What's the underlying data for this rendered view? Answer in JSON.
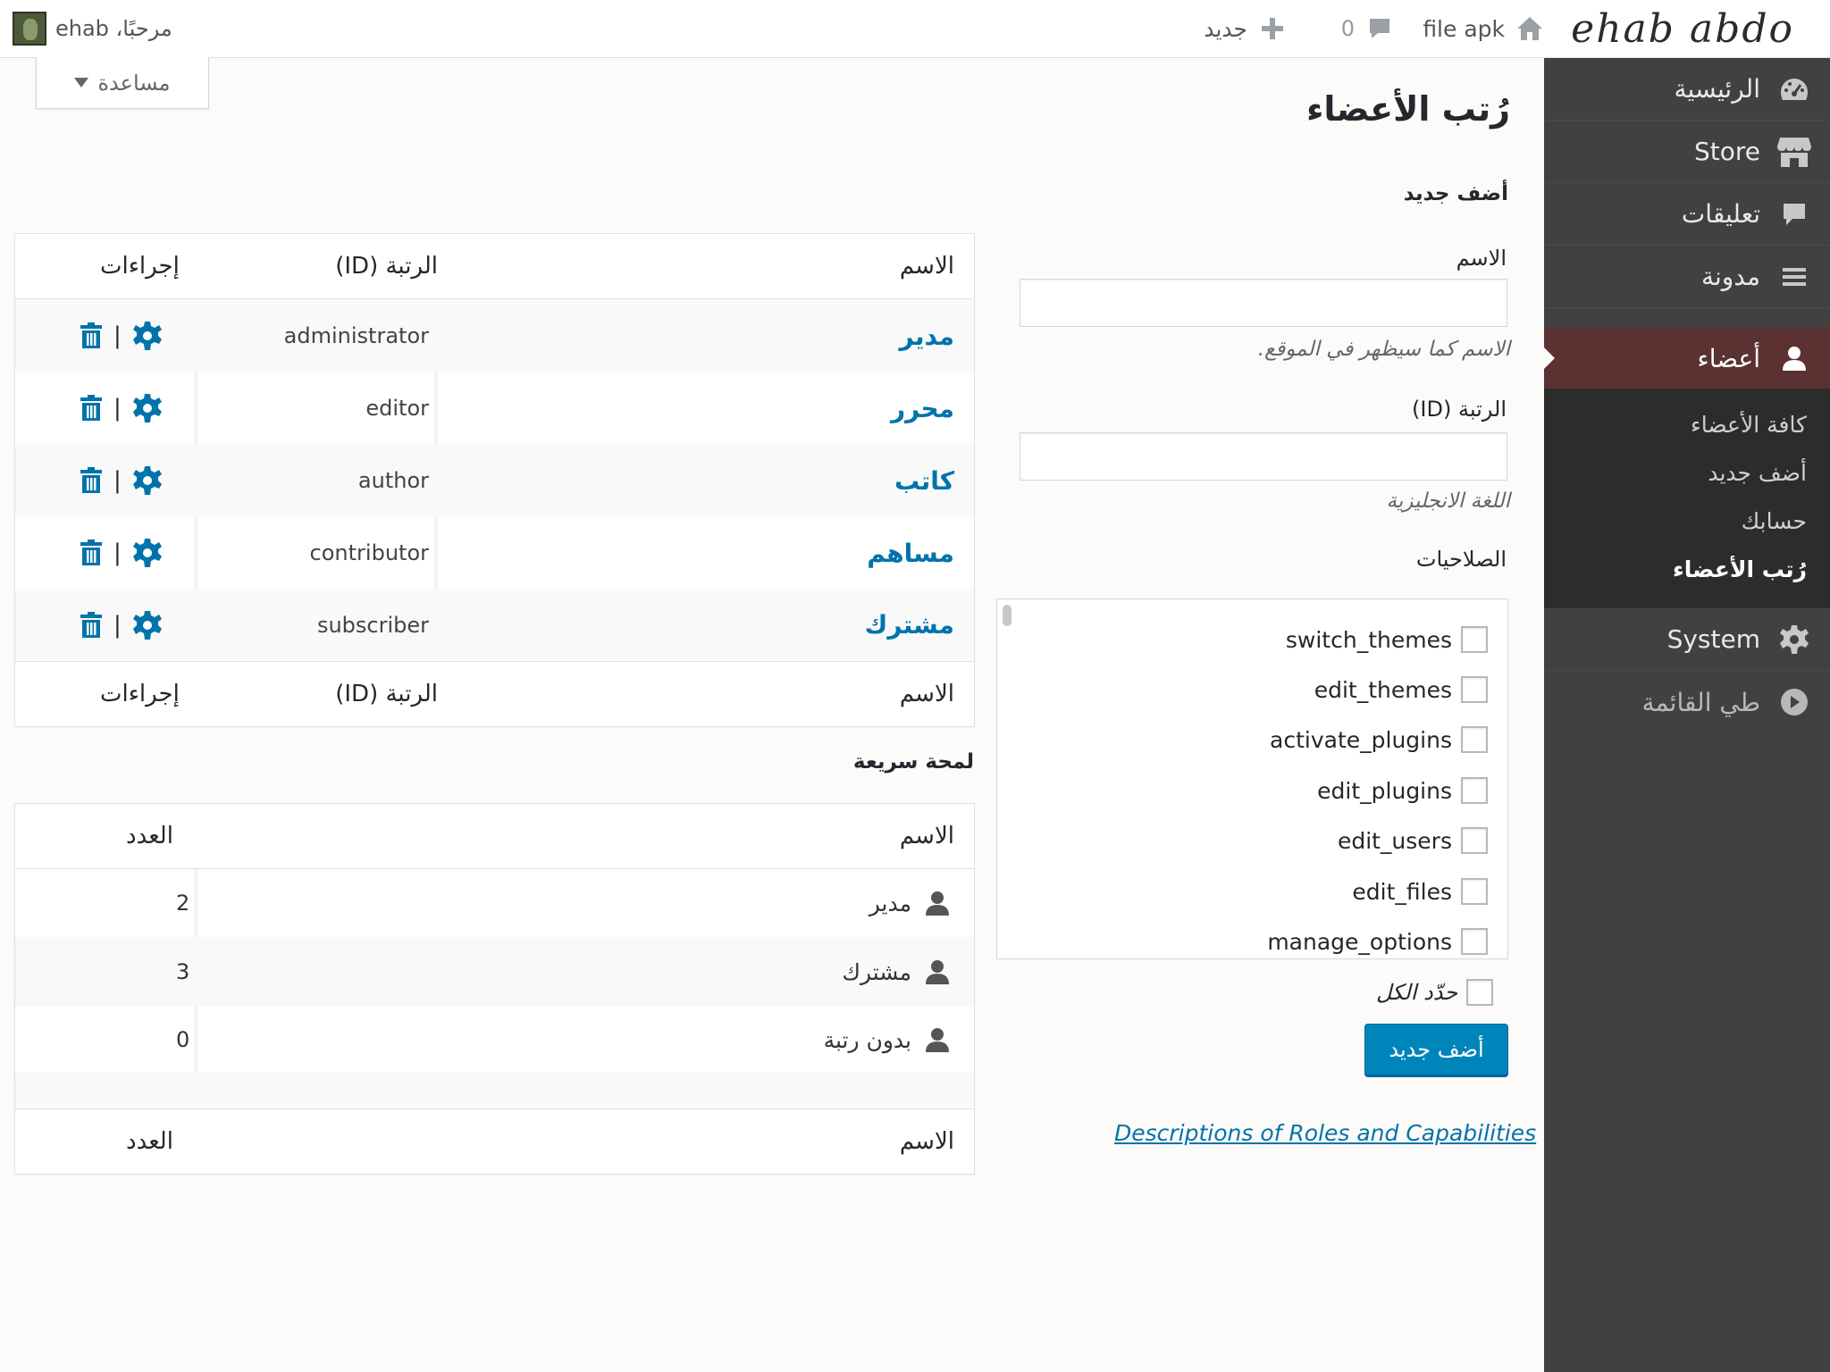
{
  "adminbar": {
    "logo": "ehab abdo",
    "site_name": "file apk",
    "comments_count": "0",
    "new_label": "جديد",
    "greeting": "مرحبًا، ehab"
  },
  "help": {
    "label": "مساعدة"
  },
  "sidebar": {
    "items": [
      {
        "label": "الرئيسية",
        "icon": "dashboard-icon"
      },
      {
        "label": "Store",
        "icon": "store-icon"
      },
      {
        "label": "تعليقات",
        "icon": "comment-icon"
      },
      {
        "label": "مدونة",
        "icon": "menu-icon"
      },
      {
        "label": "أعضاء",
        "icon": "user-icon"
      },
      {
        "label": "System",
        "icon": "gear-icon"
      },
      {
        "label": "طي القائمة",
        "icon": "collapse-icon"
      }
    ],
    "submenu": [
      "كافة الأعضاء",
      "أضف جديد",
      "حسابك",
      "رُتب الأعضاء"
    ]
  },
  "page": {
    "title": "رُتب الأعضاء"
  },
  "form": {
    "heading": "أضف جديد",
    "name_label": "الاسم",
    "name_value": "",
    "name_desc": "الاسم كما سيظهر في الموقع.",
    "id_label": "الرتبة (ID)",
    "id_value": "",
    "id_desc": "اللغة الانجليزية",
    "caps_label": "الصلاحيات",
    "capabilities": [
      "switch_themes",
      "edit_themes",
      "activate_plugins",
      "edit_plugins",
      "edit_users",
      "edit_files",
      "manage_options"
    ],
    "select_all": "حدّد الكل",
    "submit": "أضف جديد",
    "doc_link": "Descriptions of Roles and Capabilities"
  },
  "roles_table": {
    "columns": {
      "name": "الاسم",
      "slug": "الرتبة (ID)",
      "actions": "إجراءات"
    },
    "rows": [
      {
        "name": "مدير",
        "slug": "administrator"
      },
      {
        "name": "محرر",
        "slug": "editor"
      },
      {
        "name": "كاتب",
        "slug": "author"
      },
      {
        "name": "مساهم",
        "slug": "contributor"
      },
      {
        "name": "مشترك",
        "slug": "subscriber"
      }
    ],
    "action_sep": "|"
  },
  "glance": {
    "heading": "لمحة سريعة",
    "columns": {
      "name": "الاسم",
      "count": "العدد"
    },
    "rows": [
      {
        "name": "مدير",
        "count": "2"
      },
      {
        "name": "مشترك",
        "count": "3"
      },
      {
        "name": "بدون رتبة",
        "count": "0"
      }
    ]
  },
  "colors": {
    "sidebar_bg": "#414141",
    "sidebar_active": "#5b3131",
    "submenu_bg": "#2c2c2c",
    "link": "#0073aa",
    "button": "#0085ba"
  }
}
